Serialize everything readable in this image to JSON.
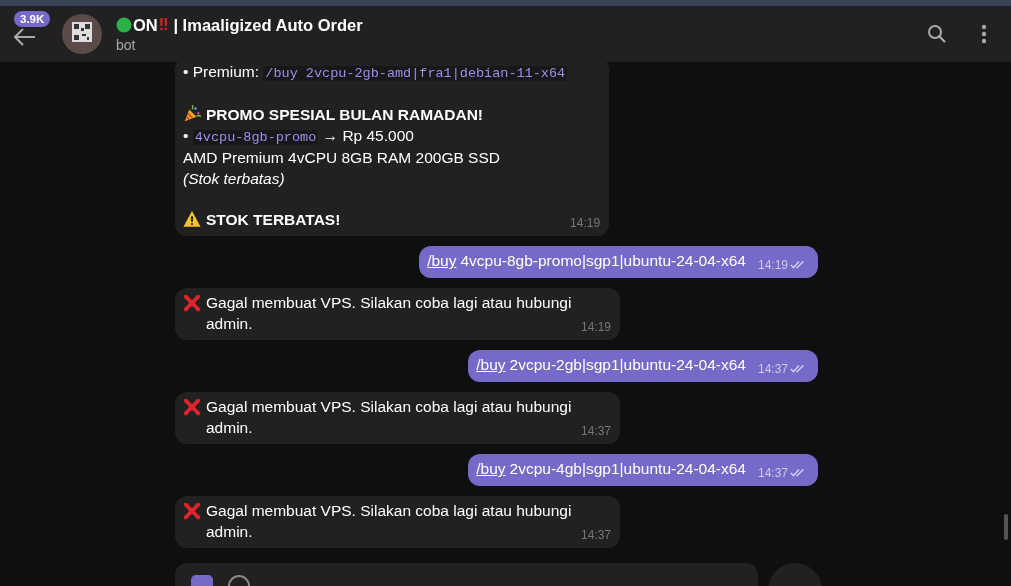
{
  "header": {
    "back_badge": "3.9K",
    "title_status": "ON",
    "title_mark": "‼",
    "title_name": "| Imaaligized Auto Order",
    "subtitle": "bot"
  },
  "messages": [
    {
      "kind": "incoming",
      "time": "14:19",
      "lines": [
        {
          "kind": "text",
          "parts": [
            {
              "kind": "text",
              "text": "• Premium: "
            },
            {
              "kind": "code",
              "text": "/buy 2vcpu-2gb-amd|fra1|debian-11-x64"
            }
          ]
        },
        {
          "kind": "blank"
        },
        {
          "kind": "text",
          "parts": [
            {
              "kind": "party-icon"
            },
            {
              "kind": "bold",
              "text": "PROMO SPESIAL BULAN RAMADAN!"
            }
          ]
        },
        {
          "kind": "text",
          "parts": [
            {
              "kind": "text",
              "text": "• "
            },
            {
              "kind": "code",
              "text": "4vcpu-8gb-promo"
            },
            {
              "kind": "text",
              "text": " → Rp 45.000"
            }
          ]
        },
        {
          "kind": "text",
          "parts": [
            {
              "kind": "text",
              "text": "AMD Premium 4vCPU 8GB RAM 200GB SSD"
            }
          ]
        },
        {
          "kind": "text",
          "parts": [
            {
              "kind": "italic",
              "text": "(Stok terbatas)"
            }
          ]
        },
        {
          "kind": "blank"
        },
        {
          "kind": "text",
          "parts": [
            {
              "kind": "warning-icon"
            },
            {
              "kind": "bold",
              "text": "STOK TERBATAS!"
            }
          ]
        }
      ]
    },
    {
      "kind": "outgoing",
      "command": "/buy",
      "text": "4vcpu-8gb-promo|sgp1|ubuntu-24-04-x64",
      "time": "14:19",
      "read": true
    },
    {
      "kind": "incoming",
      "time": "14:19",
      "lines": [
        {
          "kind": "text",
          "parts": [
            {
              "kind": "cross-icon"
            },
            {
              "kind": "text",
              "text": "Gagal membuat VPS. Silakan coba lagi atau hubungi admin."
            }
          ]
        }
      ]
    },
    {
      "kind": "outgoing",
      "command": "/buy",
      "text": "2vcpu-2gb|sgp1|ubuntu-24-04-x64",
      "time": "14:37",
      "read": true
    },
    {
      "kind": "incoming",
      "time": "14:37",
      "lines": [
        {
          "kind": "text",
          "parts": [
            {
              "kind": "cross-icon"
            },
            {
              "kind": "text",
              "text": "Gagal membuat VPS. Silakan coba lagi atau hubungi admin."
            }
          ]
        }
      ]
    },
    {
      "kind": "outgoing",
      "command": "/buy",
      "text": "2vcpu-4gb|sgp1|ubuntu-24-04-x64",
      "time": "14:37",
      "read": true
    },
    {
      "kind": "incoming",
      "time": "14:37",
      "lines": [
        {
          "kind": "text",
          "parts": [
            {
              "kind": "cross-icon"
            },
            {
              "kind": "text",
              "text": "Gagal membuat VPS. Silakan coba lagi atau hubungi admin."
            }
          ]
        }
      ]
    }
  ]
}
